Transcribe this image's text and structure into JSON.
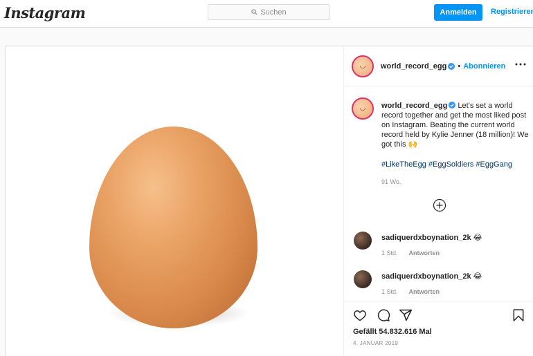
{
  "nav": {
    "logo": "Instagram",
    "search_placeholder": "Suchen",
    "login_label": "Anmelden",
    "register_label": "Registrieren"
  },
  "post": {
    "username": "world_record_egg",
    "follow_label": "Abonnieren",
    "dot": "•",
    "caption": "Let's set a world record together and get the most liked post on Instagram. Beating the current world record held by Kylie Jenner (18 million)! We got this 🙌",
    "hashtags": "#LikeTheEgg #EggSoldiers #EggGang",
    "caption_time": "91 Wo.",
    "likes_text": "Gefällt 54.832.616 Mal",
    "date": "4. JANUAR 2019"
  },
  "comments": [
    {
      "username": "sadiquerdxboynation_2k",
      "emoji": "😂",
      "time": "1 Std.",
      "reply_label": "Antworten"
    },
    {
      "username": "sadiquerdxboynation_2k",
      "emoji": "😂",
      "time": "1 Std.",
      "reply_label": "Antworten"
    }
  ],
  "icons": {
    "search": "search-icon",
    "verified": "verified-badge-icon",
    "more": "more-options-icon",
    "load_more": "plus-circle-icon",
    "like": "heart-icon",
    "comment": "comment-bubble-icon",
    "share": "paper-plane-icon",
    "save": "bookmark-icon"
  },
  "colors": {
    "accent": "#0095f6",
    "hashtag": "#00376b",
    "muted": "#8e8e8e",
    "border": "#dbdbdb",
    "story_ring": "#e1306c"
  }
}
